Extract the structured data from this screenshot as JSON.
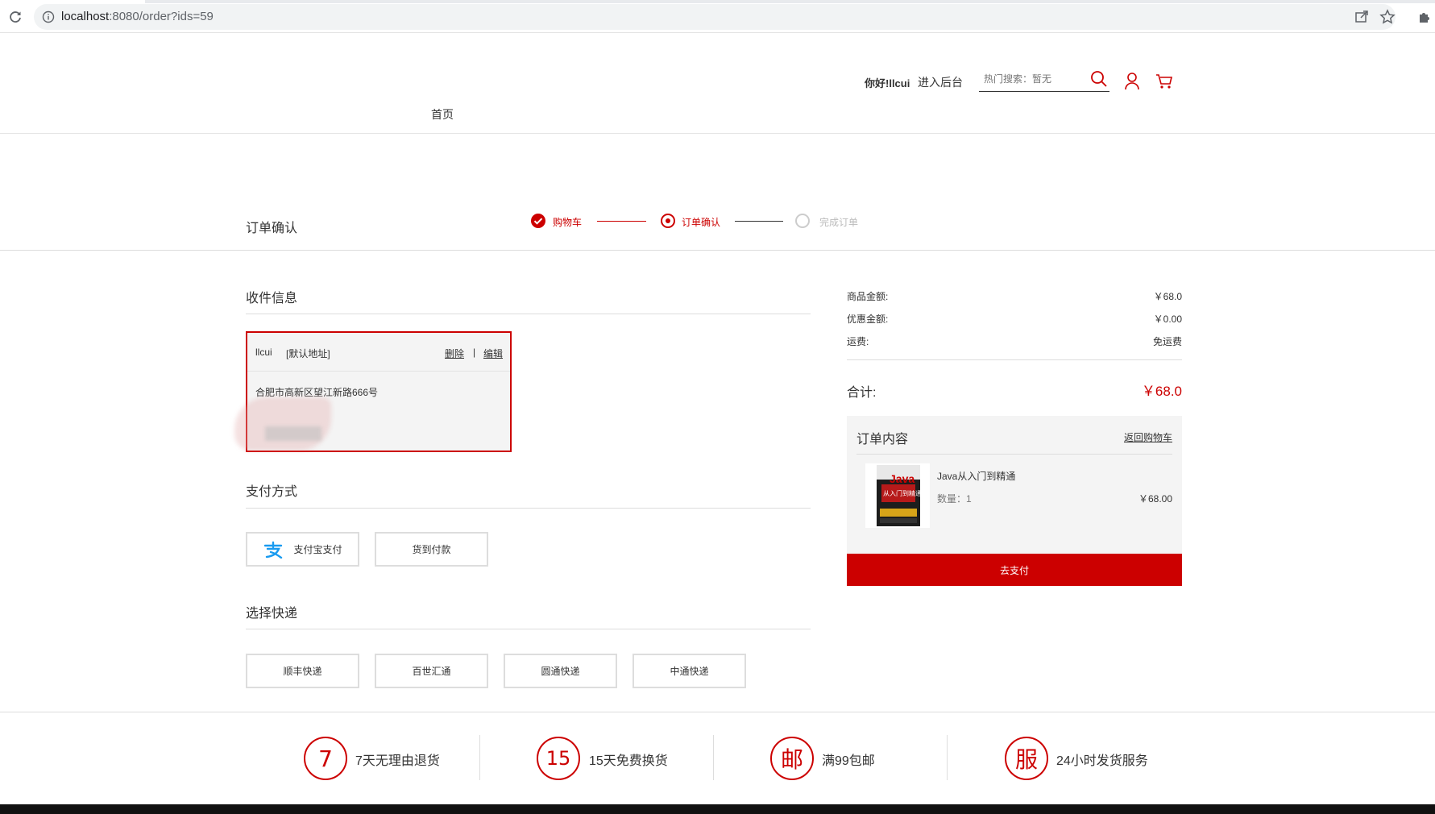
{
  "browser": {
    "url_host": "localhost",
    "url_rest": ":8080/order?ids=59"
  },
  "header": {
    "greeting": "你好!llcui",
    "admin_link": "进入后台",
    "search_placeholder": "热门搜索：暂无",
    "nav": [
      {
        "label": "首页"
      }
    ]
  },
  "steps": {
    "page_title": "订单确认",
    "items": [
      {
        "label": "购物车",
        "state": "done"
      },
      {
        "label": "订单确认",
        "state": "current"
      },
      {
        "label": "完成订单",
        "state": "pending"
      }
    ],
    "active_color": "#c00000",
    "inactive_color": "#bbbbbb"
  },
  "receiver": {
    "section_title": "收件信息",
    "name": "llcui",
    "default_tag": "[默认地址]",
    "delete_label": "删除",
    "separator": "|",
    "edit_label": "编辑",
    "address": "合肥市高新区望江新路666号"
  },
  "payment": {
    "section_title": "支付方式",
    "options": [
      {
        "label": "支付宝支付",
        "icon": "alipay-icon"
      },
      {
        "label": "货到付款"
      }
    ]
  },
  "shipping": {
    "section_title": "选择快递",
    "options": [
      {
        "label": "顺丰快递"
      },
      {
        "label": "百世汇通"
      },
      {
        "label": "圆通快递"
      },
      {
        "label": "中通快递"
      }
    ]
  },
  "summary": {
    "goods_label": "商品金额:",
    "goods_value": "￥68.0",
    "discount_label": "优惠金额:",
    "discount_value": "￥0.00",
    "freight_label": "运费:",
    "freight_value": "免运费",
    "total_label": "合计:",
    "total_value": "￥68.0"
  },
  "order": {
    "title": "订单内容",
    "back_link": "返回购物车",
    "items": [
      {
        "name": "Java从入门到精通",
        "qty": "数量：1",
        "price": "￥68.00",
        "cover_text": "Java",
        "cover_sub": "从入门到精通"
      }
    ],
    "pay_button": "去支付"
  },
  "footer": {
    "items": [
      {
        "glyph": "7",
        "text": "7天无理由退货"
      },
      {
        "glyph": "15",
        "text": "15天免费换货"
      },
      {
        "glyph": "邮",
        "text": "满99包邮"
      },
      {
        "glyph": "服",
        "text": "24小时发货服务"
      }
    ]
  },
  "colors": {
    "brand_red": "#c00000",
    "line": "#dddddd",
    "panel_bg": "#f4f4f4"
  }
}
